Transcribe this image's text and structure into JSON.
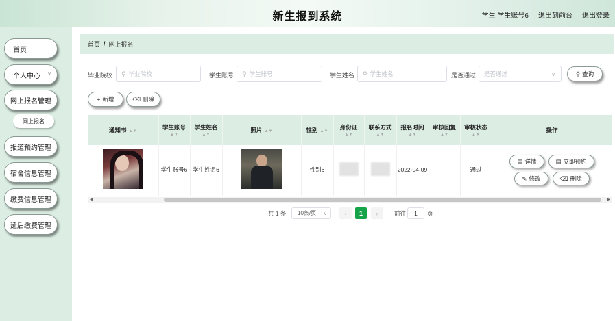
{
  "header": {
    "title": "新生报到系统",
    "user_label": "学生 学生账号6",
    "back_frontend": "退出到前台",
    "logout": "退出登录"
  },
  "sidebar": {
    "items": [
      {
        "label": "首页"
      },
      {
        "label": "个人中心"
      },
      {
        "label": "网上报名管理"
      },
      {
        "label": "报道预约管理"
      },
      {
        "label": "宿舍信息管理"
      },
      {
        "label": "缴费信息管理"
      },
      {
        "label": "延后缴费管理"
      }
    ],
    "sub_item": "网上报名"
  },
  "breadcrumb": {
    "home": "首页",
    "sep": "/",
    "current": "网上报名"
  },
  "search": {
    "school_label": "毕业院校",
    "school_placeholder": "毕业院校",
    "account_label": "学生账号",
    "account_placeholder": "学生账号",
    "name_label": "学生姓名",
    "name_placeholder": "学生姓名",
    "passed_label": "是否通过",
    "passed_placeholder": "是否通过",
    "query_button": "查询"
  },
  "toolbar": {
    "add": "新增",
    "delete": "删除"
  },
  "table": {
    "headers": {
      "notice": "通知书",
      "account": "学生账号",
      "name": "学生姓名",
      "photo": "照片",
      "gender": "性别",
      "id_card": "身份证",
      "contact": "联系方式",
      "reg_time": "报名时间",
      "review_reply": "审核回复",
      "review_status": "审核状态",
      "actions": "操作"
    },
    "rows": [
      {
        "account": "学生账号6",
        "name": "学生姓名6",
        "gender": "性别6",
        "reg_time": "2022-04-09",
        "review_reply": "",
        "review_status": "通过",
        "actions": {
          "detail": "详情",
          "reserve": "立即预约",
          "edit": "修改",
          "delete": "删除"
        }
      }
    ]
  },
  "pagination": {
    "total": "共 1 条",
    "page_size": "10条/页",
    "current_page": "1",
    "goto_label": "前往",
    "goto_value": "1",
    "page_suffix": "页"
  }
}
